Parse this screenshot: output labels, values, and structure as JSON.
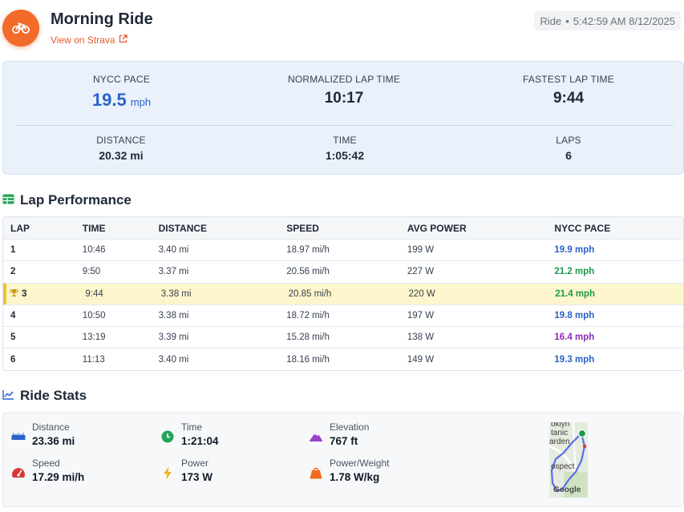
{
  "header": {
    "title": "Morning Ride",
    "strava_link": "View on Strava",
    "activity_type": "Ride",
    "separator": "•",
    "datetime": "5:42:59 AM 8/12/2025",
    "logo_icon": "bicycle-icon",
    "brand_color": "#f26b2a"
  },
  "summary": {
    "nycc_pace": {
      "label": "NYCC PACE",
      "value": "19.5",
      "unit": "mph"
    },
    "normalized_lap_time": {
      "label": "NORMALIZED LAP TIME",
      "value": "10:17"
    },
    "fastest_lap_time": {
      "label": "FASTEST LAP TIME",
      "value": "9:44"
    },
    "distance": {
      "label": "DISTANCE",
      "value": "20.32 mi"
    },
    "time": {
      "label": "TIME",
      "value": "1:05:42"
    },
    "laps": {
      "label": "LAPS",
      "value": "6"
    }
  },
  "lap_performance": {
    "title": "Lap Performance",
    "icon": "table-icon",
    "columns": [
      "LAP",
      "TIME",
      "DISTANCE",
      "SPEED",
      "AVG POWER",
      "NYCC PACE"
    ],
    "rows": [
      {
        "lap": "1",
        "time": "10:46",
        "distance": "3.40 mi",
        "speed": "18.97 mi/h",
        "power": "199 W",
        "pace": "19.9 mph",
        "pace_color": "#2a62c9"
      },
      {
        "lap": "2",
        "time": "9:50",
        "distance": "3.37 mi",
        "speed": "20.56 mi/h",
        "power": "227 W",
        "pace": "21.2 mph",
        "pace_color": "#1f9a4a"
      },
      {
        "lap": "3",
        "time": "9:44",
        "distance": "3.38 mi",
        "speed": "20.85 mi/h",
        "power": "220 W",
        "pace": "21.4 mph",
        "pace_color": "#1f9a4a",
        "best": true
      },
      {
        "lap": "4",
        "time": "10:50",
        "distance": "3.38 mi",
        "speed": "18.72 mi/h",
        "power": "197 W",
        "pace": "19.8 mph",
        "pace_color": "#2a62c9"
      },
      {
        "lap": "5",
        "time": "13:19",
        "distance": "3.39 mi",
        "speed": "15.28 mi/h",
        "power": "138 W",
        "pace": "16.4 mph",
        "pace_color": "#8e2bb8"
      },
      {
        "lap": "6",
        "time": "11:13",
        "distance": "3.40 mi",
        "speed": "18.16 mi/h",
        "power": "149 W",
        "pace": "19.3 mph",
        "pace_color": "#2a62c9"
      }
    ],
    "best_row_color": "#fdf6cc"
  },
  "ride_stats": {
    "title": "Ride Stats",
    "icon": "line-chart-icon",
    "items": [
      {
        "label": "Distance",
        "value": "23.36 mi",
        "icon": "ruler-icon"
      },
      {
        "label": "Time",
        "value": "1:21:04",
        "icon": "clock-icon"
      },
      {
        "label": "Elevation",
        "value": "767 ft",
        "icon": "mountain-icon"
      },
      {
        "label": "Speed",
        "value": "17.29 mi/h",
        "icon": "speedometer-icon"
      },
      {
        "label": "Power",
        "value": "173 W",
        "icon": "lightning-icon"
      },
      {
        "label": "Power/Weight",
        "value": "1.78 W/kg",
        "icon": "weight-icon"
      }
    ],
    "map": {
      "labels": [
        "oklyn",
        "tanic",
        "arden",
        "ospect",
        "Google"
      ]
    }
  }
}
